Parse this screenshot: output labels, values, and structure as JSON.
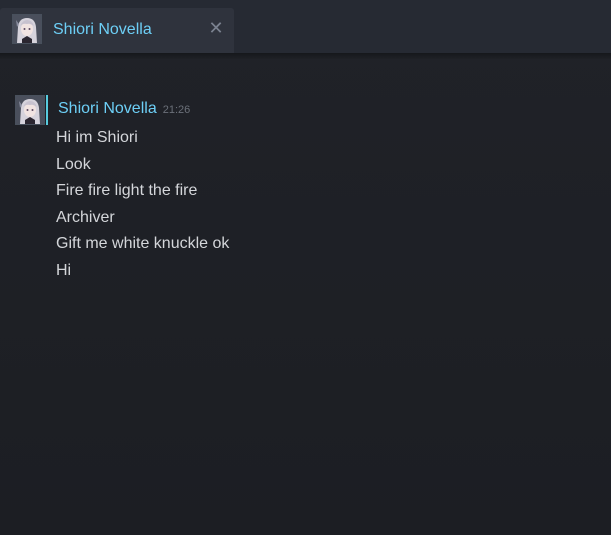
{
  "tab": {
    "label": "Shiori Novella",
    "close_glyph": "✕"
  },
  "chat": {
    "sender": "Shiori Novella",
    "time": "21:26",
    "messages": [
      "Hi im Shiori",
      "Look",
      "Fire fire light the fire",
      "Archiver",
      "Gift me white knuckle ok",
      "Hi"
    ]
  },
  "icons": {
    "tab_avatar": "user-avatar",
    "close": "close-icon",
    "message_avatar": "user-avatar"
  },
  "colors": {
    "accent": "#6dcff6",
    "online_status": "#57cbde",
    "message_text": "#d4d6da",
    "background": "#1f2126",
    "tab_active": "#2f333d"
  }
}
